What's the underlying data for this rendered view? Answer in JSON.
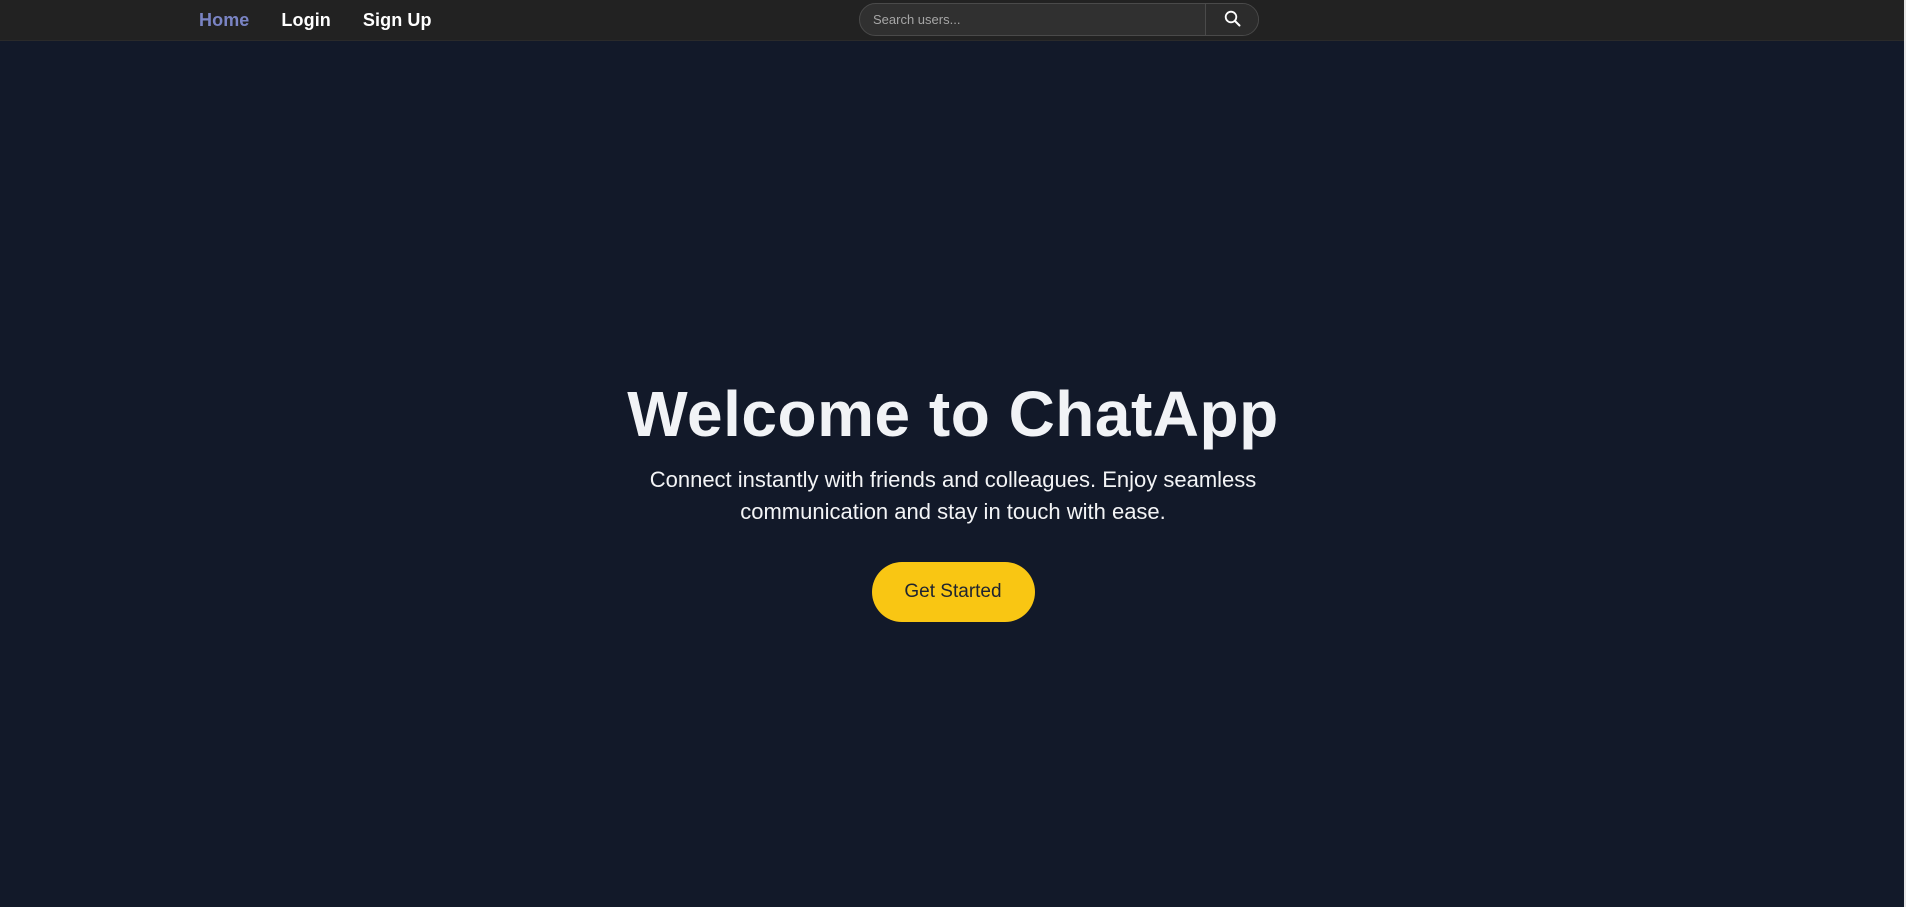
{
  "nav": {
    "links": [
      {
        "label": "Home"
      },
      {
        "label": "Login"
      },
      {
        "label": "Sign Up"
      }
    ],
    "search": {
      "placeholder": "Search users...",
      "button_icon": "search-icon"
    }
  },
  "hero": {
    "title": "Welcome to ChatApp",
    "subtitle": "Connect instantly with friends and colleagues. Enjoy seamless communication and stay in touch with ease.",
    "cta_label": "Get Started"
  },
  "colors": {
    "background": "#121929",
    "navbar": "#222222",
    "active_link": "#7a84c4",
    "cta": "#f9c613"
  }
}
